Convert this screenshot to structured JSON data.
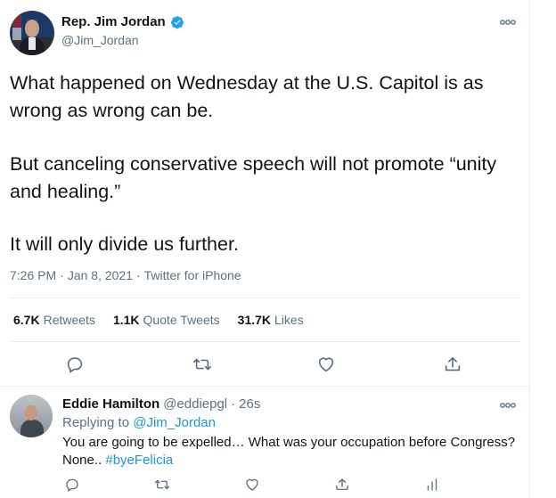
{
  "tweet": {
    "author_name": "Rep. Jim Jordan",
    "author_handle": "@Jim_Jordan",
    "text_p1": "What happened on Wednesday at the U.S. Capitol is as wrong as wrong can be.",
    "text_p2": "But canceling conservative speech will not promote “unity and healing.”",
    "text_p3": "It will only divide us further.",
    "time": "7:26 PM",
    "date": "Jan 8, 2021",
    "source": "Twitter for iPhone",
    "separator": "·",
    "stats": {
      "retweets_count": "6.7K",
      "retweets_label": "Retweets",
      "quote_count": "1.1K",
      "quote_label": "Quote Tweets",
      "likes_count": "31.7K",
      "likes_label": "Likes"
    }
  },
  "reply": {
    "author_name": "Eddie Hamilton",
    "author_handle": "@eddiepgl",
    "age": "26s",
    "replying_prefix": "Replying to",
    "replying_to": "@Jim_Jordan",
    "text_main": "You are going to be expelled… What was your occupation before Congress? None.. ",
    "hashtag": "#byeFelicia"
  },
  "icons": {
    "verified": "verified-badge-icon",
    "more": "more-dots-icon",
    "reply": "reply-bubble-icon",
    "retweet": "retweet-icon",
    "like": "heart-icon",
    "share": "share-icon",
    "analytics": "analytics-icon"
  },
  "colors": {
    "text": "#0f1419",
    "secondary": "#5b7083",
    "accent": "#1b95e0",
    "divider": "#ebeef0"
  }
}
